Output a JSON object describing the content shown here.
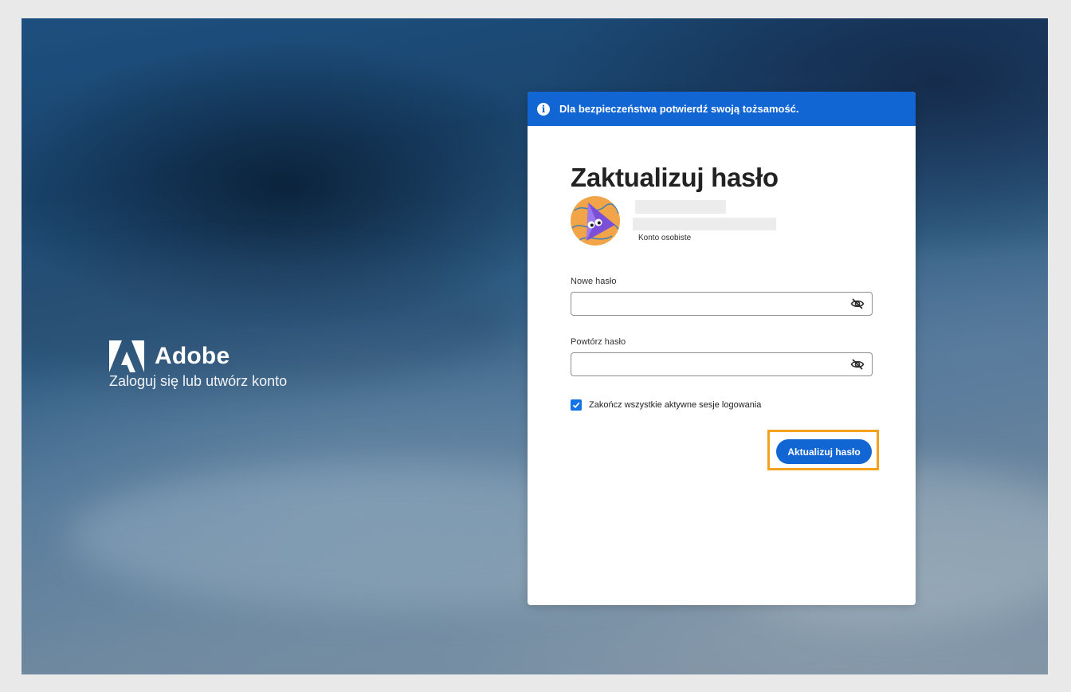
{
  "brand": {
    "name": "Adobe",
    "tagline": "Zaloguj się lub utwórz konto"
  },
  "banner": {
    "text": "Dla bezpieczeństwa potwierdź swoją tożsamość.",
    "icon": "info-icon"
  },
  "form": {
    "title": "Zaktualizuj hasło",
    "account_type": "Konto osobiste",
    "new_password": {
      "label": "Nowe hasło",
      "value": "",
      "toggle_icon": "eye-off-icon"
    },
    "repeat_password": {
      "label": "Powtórz hasło",
      "value": "",
      "toggle_icon": "eye-off-icon"
    },
    "end_sessions": {
      "label": "Zakończ wszystkie aktywne sesje logowania",
      "checked": true
    },
    "submit_label": "Aktualizuj hasło"
  },
  "colors": {
    "accent": "#1266d4",
    "highlight": "#f4a11d",
    "avatar_bg": "#f2a548"
  }
}
